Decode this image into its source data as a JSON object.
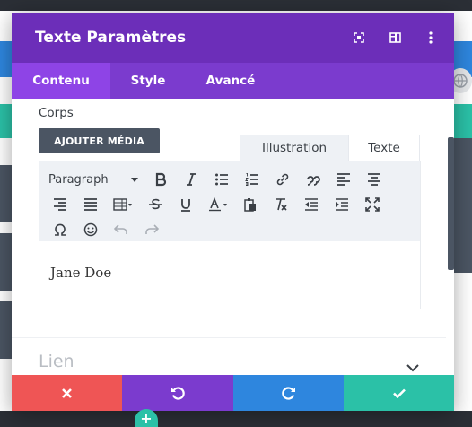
{
  "modal": {
    "title": "Texte Paramètres",
    "tabs": [
      {
        "label": "Contenu",
        "active": true
      },
      {
        "label": "Style",
        "active": false
      },
      {
        "label": "Avancé",
        "active": false
      }
    ]
  },
  "content": {
    "field_label": "Corps",
    "add_media_label": "AJOUTER MÉDIA",
    "editor_tabs": [
      "Illustration",
      "Texte"
    ],
    "paragraph_select": "Paragraph",
    "body_text": "Jane Doe",
    "section_label": "Lien"
  },
  "colors": {
    "header": "#6c2eb9",
    "tabs_bg": "#7b3bce",
    "tab_active": "#8e44e6",
    "cancel": "#ef5555",
    "undo": "#7b3bce",
    "redo": "#2e86de",
    "save": "#2bc1a7"
  },
  "footer_icons": [
    "close-icon",
    "undo-icon",
    "redo-icon",
    "check-icon"
  ]
}
